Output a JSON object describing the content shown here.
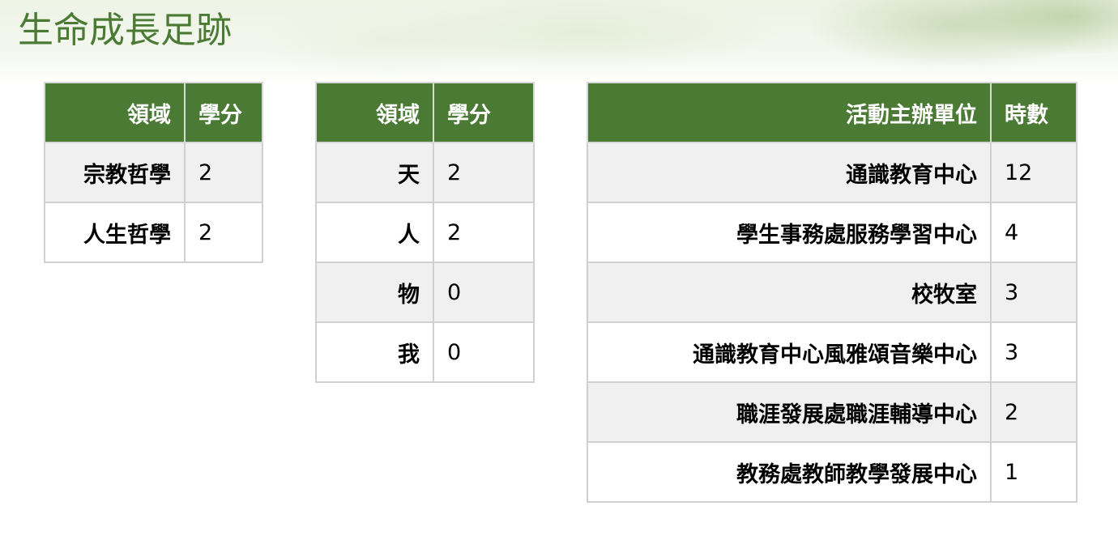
{
  "page_title": "生命成長足跡",
  "table_domain_credits_1": {
    "headers": {
      "domain": "領域",
      "credits": "學分"
    },
    "rows": [
      {
        "domain": "宗教哲學",
        "credits": "2"
      },
      {
        "domain": "人生哲學",
        "credits": "2"
      }
    ]
  },
  "table_domain_credits_2": {
    "headers": {
      "domain": "領域",
      "credits": "學分"
    },
    "rows": [
      {
        "domain": "天",
        "credits": "2"
      },
      {
        "domain": "人",
        "credits": "2"
      },
      {
        "domain": "物",
        "credits": "0"
      },
      {
        "domain": "我",
        "credits": "0"
      }
    ]
  },
  "table_activity_hours": {
    "headers": {
      "organizer": "活動主辦單位",
      "hours": "時數"
    },
    "rows": [
      {
        "organizer": "通識教育中心",
        "hours": "12"
      },
      {
        "organizer": "學生事務處服務學習中心",
        "hours": "4"
      },
      {
        "organizer": "校牧室",
        "hours": "3"
      },
      {
        "organizer": "通識教育中心風雅頌音樂中心",
        "hours": "3"
      },
      {
        "organizer": "職涯發展處職涯輔導中心",
        "hours": "2"
      },
      {
        "organizer": "教務處教師教學發展中心",
        "hours": "1"
      }
    ]
  },
  "colors": {
    "header_green": "#4a7a34",
    "title_green": "#4a7a34",
    "stripe_gray": "#f0f0f0",
    "border_gray": "#d0d0d0"
  }
}
